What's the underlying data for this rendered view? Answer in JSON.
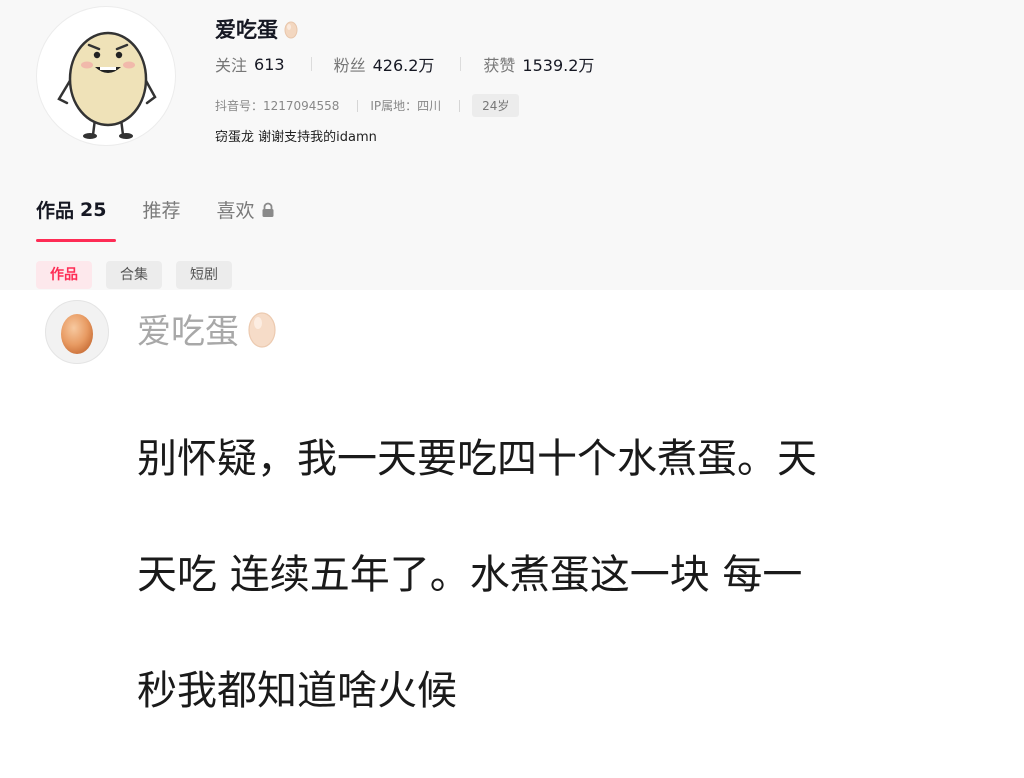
{
  "profile": {
    "nickname": "爱吃蛋",
    "avatar_icon": "egg-character-avatar",
    "stats": [
      {
        "label": "关注",
        "value": "613"
      },
      {
        "label": "粉丝",
        "value": "426.2万"
      },
      {
        "label": "获赞",
        "value": "1539.2万"
      }
    ],
    "douyin_id": "抖音号：1217094558",
    "ip_location": "IP属地：四川",
    "age": "24岁",
    "bio": "窃蛋龙 谢谢支持我的idamn"
  },
  "tabs": [
    {
      "label": "作品",
      "count": "25"
    },
    {
      "label": "推荐"
    },
    {
      "label": "喜欢",
      "icon": "lock-icon"
    }
  ],
  "subtabs": [
    "作品",
    "合集",
    "短剧"
  ],
  "comment": {
    "author": "爱吃蛋",
    "line1": "别怀疑，我一天要吃四十个水煮蛋。天",
    "line2": "天吃 连续五年了。水煮蛋这一块 每一",
    "line3": "秒我都知道啥火候"
  },
  "colors": {
    "accent": "#fe2c55",
    "panel_bg": "#f8f8f8",
    "egg_shell": "#f3d7c0"
  }
}
